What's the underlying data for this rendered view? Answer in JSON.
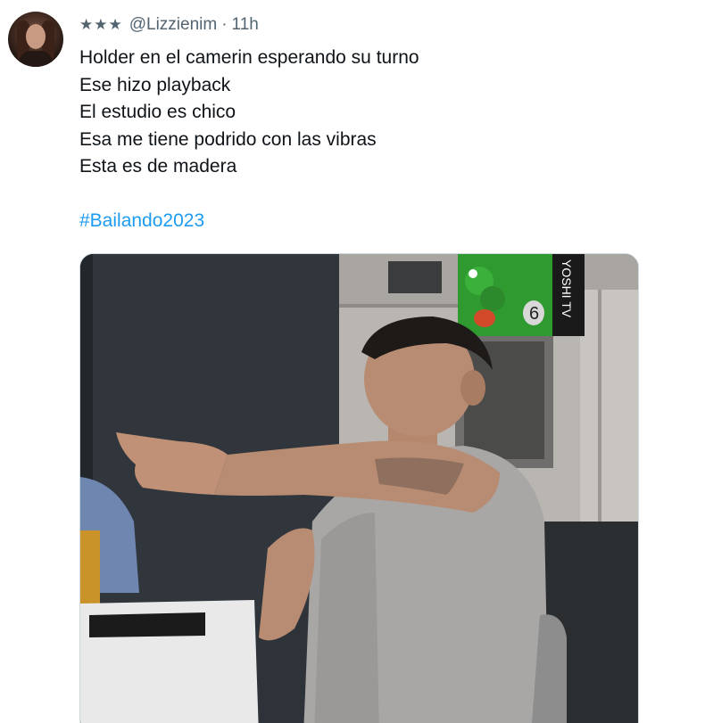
{
  "tweet": {
    "stars": "★★★",
    "handle": "@Lizzienim",
    "separator": "·",
    "time": "11h",
    "lines": [
      "Holder en el camerin esperando su turno",
      "Ese hizo playback",
      "El estudio es chico",
      "Esa me tiene podrido con las vibras",
      "Esta es de madera"
    ],
    "hashtag": "#Bailando2023"
  },
  "media": {
    "watermark": "YOSHI TV",
    "watermark_number": "6"
  },
  "colors": {
    "hashtag": "#1d9bf0",
    "secondary_text": "#536471",
    "primary_text": "#0f1419"
  }
}
